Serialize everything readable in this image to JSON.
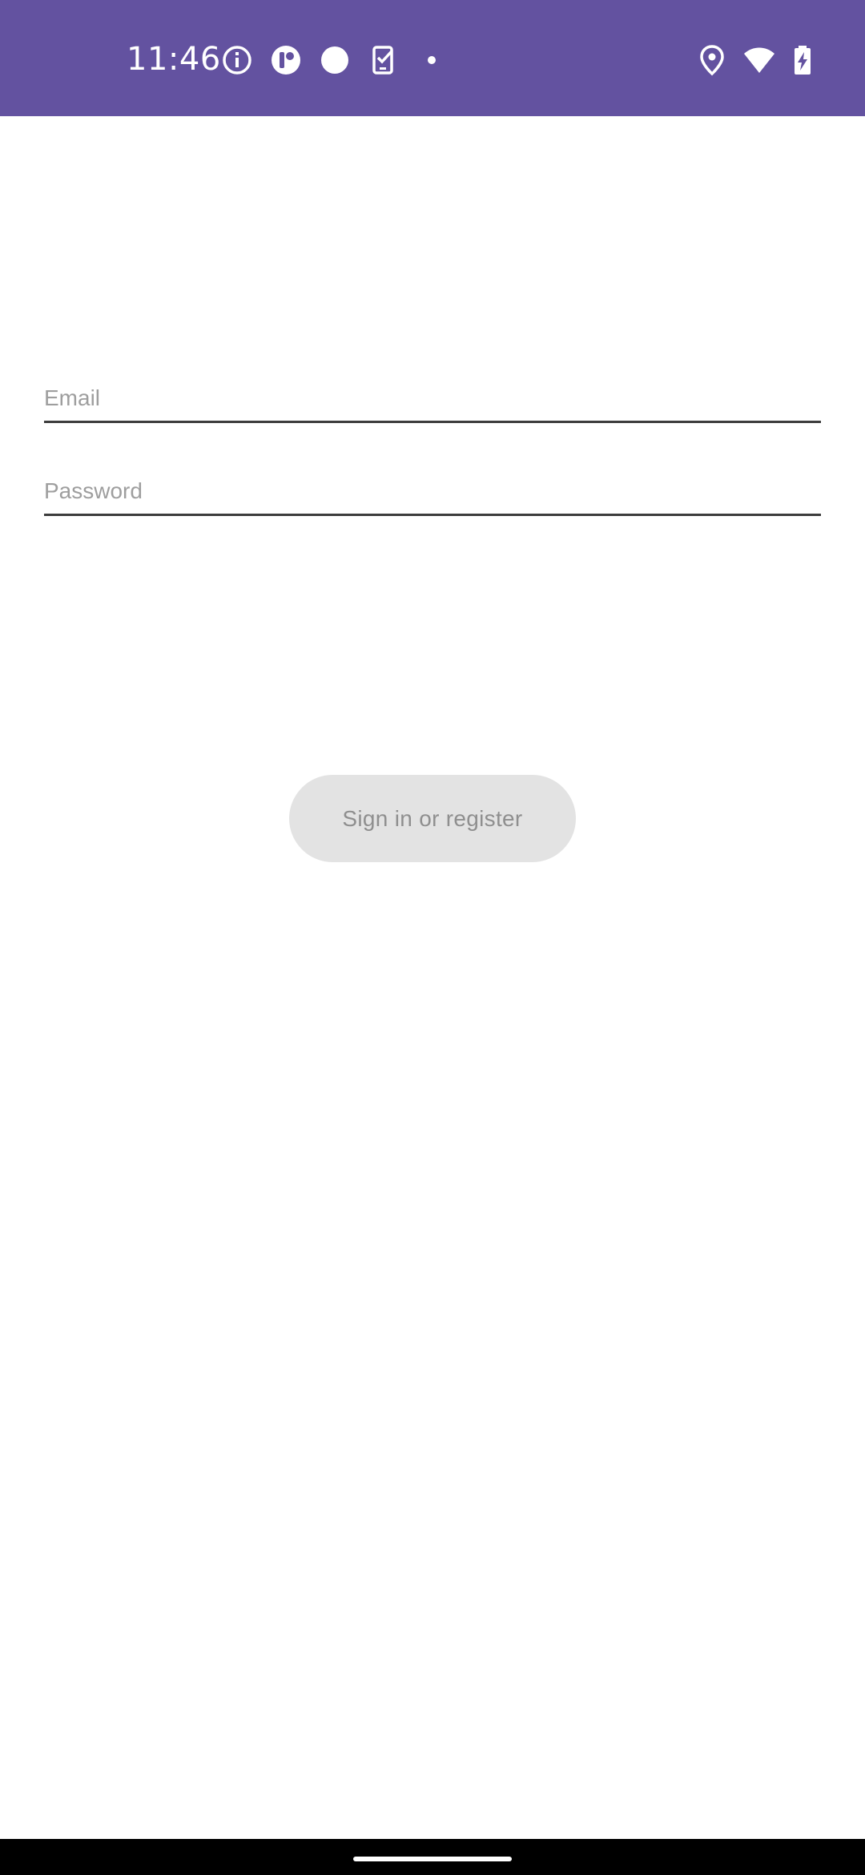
{
  "status_bar": {
    "time": "11:46",
    "background_color": "#6352a0",
    "left_icons": [
      "info-icon",
      "app-notification-icon",
      "circle-notification-icon",
      "task-phone-icon",
      "dot-icon"
    ],
    "right_icons": [
      "location-icon",
      "wifi-icon",
      "battery-charging-icon"
    ]
  },
  "form": {
    "email_placeholder": "Email",
    "email_value": "",
    "password_placeholder": "Password",
    "password_value": "",
    "submit_label": "Sign in or register",
    "submit_enabled": false
  }
}
